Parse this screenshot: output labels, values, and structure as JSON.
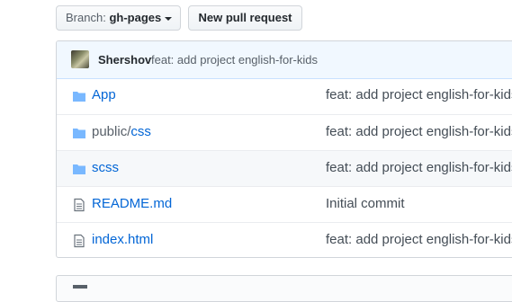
{
  "toolbar": {
    "branch_prefix": "Branch:",
    "branch_name": "gh-pages",
    "new_pr_label": "New pull request"
  },
  "latest_commit": {
    "author": "Shershov",
    "message": "feat: add project english-for-kids"
  },
  "files": [
    {
      "type": "folder",
      "icon": "folder-icon",
      "name": "App",
      "commit": "feat: add project english-for-kids"
    },
    {
      "type": "folder",
      "icon": "folder-icon",
      "name_dir": "public/",
      "name": "css",
      "commit": "feat: add project english-for-kids"
    },
    {
      "type": "folder",
      "icon": "folder-icon",
      "name": "scss",
      "commit": "feat: add project english-for-kids"
    },
    {
      "type": "file",
      "icon": "file-icon",
      "name": "README.md",
      "commit": "Initial commit"
    },
    {
      "type": "file",
      "icon": "file-icon",
      "name": "index.html",
      "commit": "feat: add project english-for-kids"
    }
  ],
  "colors": {
    "link": "#0366d6",
    "folder_icon": "#79b8ff",
    "commit_bar_bg": "#f1f8ff"
  }
}
